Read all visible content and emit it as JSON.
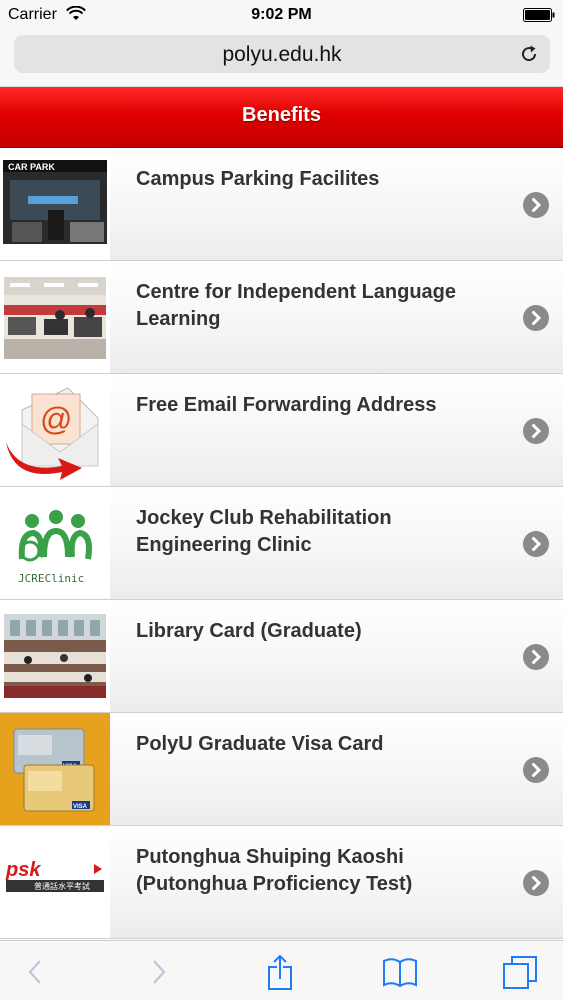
{
  "status_bar": {
    "carrier": "Carrier",
    "time": "9:02 PM"
  },
  "browser": {
    "url": "polyu.edu.hk"
  },
  "header": {
    "title": "Benefits"
  },
  "benefits": [
    {
      "label": "Campus Parking Facilites"
    },
    {
      "label": "Centre for Independent Language Learning"
    },
    {
      "label": "Free Email Forwarding Address"
    },
    {
      "label": "Jockey Club Rehabilitation Engineering Clinic"
    },
    {
      "label": "Library Card (Graduate)"
    },
    {
      "label": "PolyU Graduate Visa Card"
    },
    {
      "label": "Putonghua Shuiping Kaoshi (Putonghua Proficiency Test)"
    }
  ],
  "thumbs": {
    "car_park_sign": "CAR PARK",
    "jcre_label": "JCREClinic",
    "visa_label": "VISA",
    "psk_label": "psk",
    "psk_chinese": "普通話水平考試"
  },
  "colors": {
    "header_red": "#e00000",
    "ios_blue": "#1f7bf6",
    "chevron_gray": "#8a8a8a"
  },
  "toolbar": {
    "icons": [
      "back-icon",
      "forward-icon",
      "share-icon",
      "bookmarks-icon",
      "tabs-icon"
    ]
  }
}
